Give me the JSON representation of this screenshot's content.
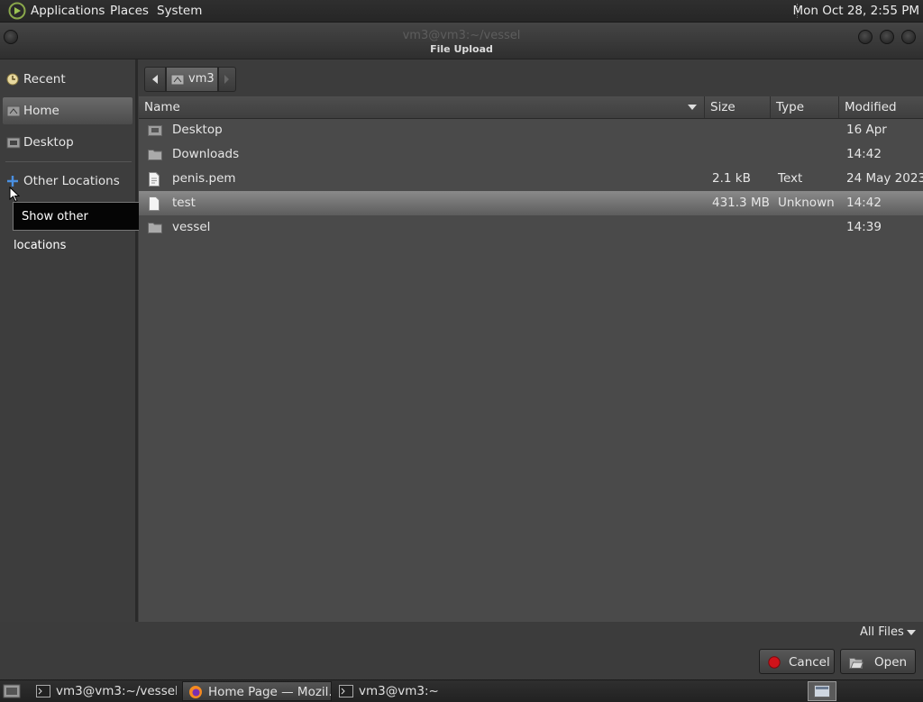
{
  "top_panel": {
    "menus": [
      "Applications",
      "Places",
      "System"
    ],
    "clock": "Mon Oct 28,  2:55 PM"
  },
  "window": {
    "title": "vm3@vm3:~/vessel",
    "dialog_title": "File Upload"
  },
  "sidebar": {
    "items": [
      {
        "label": "Recent",
        "icon": "clock-icon"
      },
      {
        "label": "Home",
        "icon": "home-icon",
        "selected": true
      },
      {
        "label": "Desktop",
        "icon": "desktop-icon"
      },
      {
        "label": "Other Locations",
        "icon": "plus-icon"
      }
    ],
    "tooltip": "Show other locations"
  },
  "pathbar": {
    "crumb": "vm3"
  },
  "filelist": {
    "columns": [
      "Name",
      "Size",
      "Type",
      "Modified"
    ],
    "rows": [
      {
        "name": "Desktop",
        "size": "",
        "type": "",
        "modified": "16 Apr",
        "icon": "folder-desktop-icon"
      },
      {
        "name": "Downloads",
        "size": "",
        "type": "",
        "modified": "14:42",
        "icon": "folder-icon"
      },
      {
        "name": "penis.pem",
        "size": "2.1 kB",
        "type": "Text",
        "modified": "24 May 2023",
        "icon": "text-file-icon"
      },
      {
        "name": "test",
        "size": "431.3 MB",
        "type": "Unknown",
        "modified": "14:42",
        "icon": "file-icon",
        "selected": true
      },
      {
        "name": "vessel",
        "size": "",
        "type": "",
        "modified": "14:39",
        "icon": "folder-icon"
      }
    ]
  },
  "filter": {
    "label": "All Files"
  },
  "buttons": {
    "cancel": "Cancel",
    "open": "Open"
  },
  "taskbar": {
    "tasks": [
      {
        "label": "vm3@vm3:~/vessel",
        "icon": "terminal-icon"
      },
      {
        "label": "Home Page — Mozil…",
        "icon": "firefox-icon",
        "active": true
      },
      {
        "label": "vm3@vm3:~",
        "icon": "terminal-icon"
      }
    ]
  },
  "colors": {
    "accent_red": "#d0121a",
    "selection": "#7a7a7a"
  }
}
